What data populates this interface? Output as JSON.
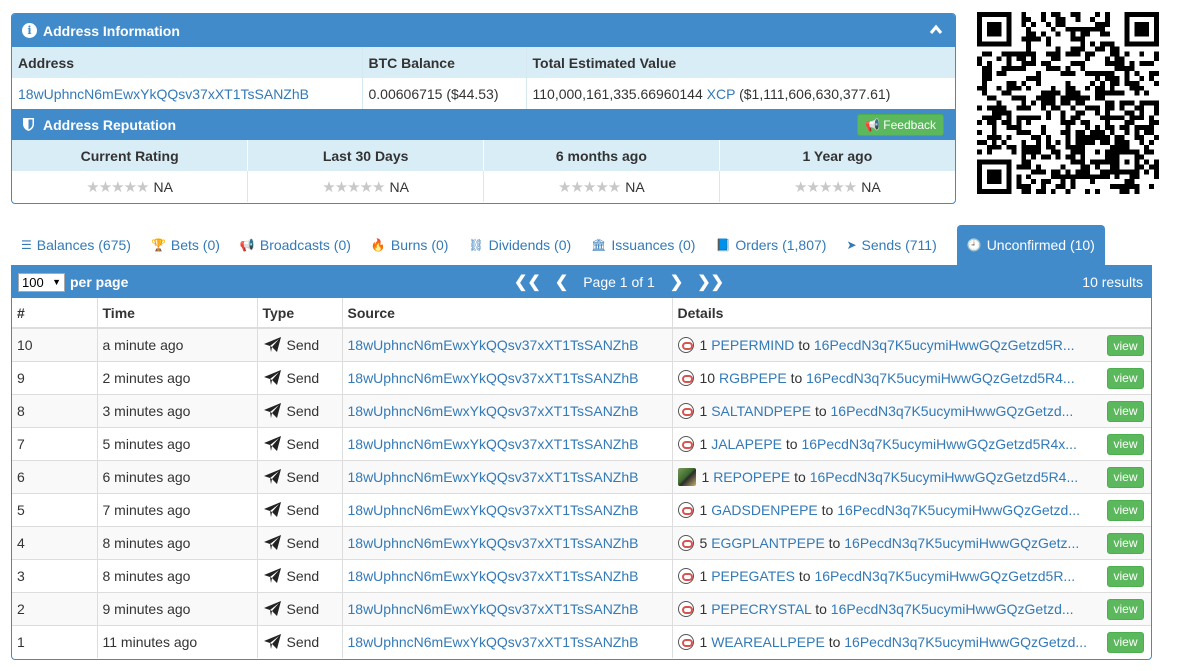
{
  "address_panel": {
    "title": "Address Information",
    "headers": [
      "Address",
      "BTC Balance",
      "Total Estimated Value"
    ],
    "address": "18wUphncN6mEwxYkQQsv37xXT1TsSANZhB",
    "btc_balance": "0.00606715 ($44.53)",
    "total_value_amount": "110,000,161,335.66960144",
    "total_value_unit": "XCP",
    "total_value_usd": "($1,111,606,630,377.61)"
  },
  "reputation": {
    "title": "Address Reputation",
    "feedback_label": "Feedback",
    "headers": [
      "Current Rating",
      "Last 30 Days",
      "6 months ago",
      "1 Year ago"
    ],
    "values": [
      "NA",
      "NA",
      "NA",
      "NA"
    ]
  },
  "tabs": [
    {
      "label": "Balances (675)",
      "icon": "list-icon",
      "glyph": "☰"
    },
    {
      "label": "Bets (0)",
      "icon": "trophy-icon",
      "glyph": "🏆"
    },
    {
      "label": "Broadcasts (0)",
      "icon": "bullhorn-icon",
      "glyph": "📢"
    },
    {
      "label": "Burns (0)",
      "icon": "fire-icon",
      "glyph": "🔥"
    },
    {
      "label": "Dividends (0)",
      "icon": "sitemap-icon",
      "glyph": "⛓"
    },
    {
      "label": "Issuances (0)",
      "icon": "bank-icon",
      "glyph": "🏛"
    },
    {
      "label": "Orders (1,807)",
      "icon": "book-icon",
      "glyph": "📘"
    },
    {
      "label": "Sends (711)",
      "icon": "send-icon",
      "glyph": "➤"
    },
    {
      "label": "Unconfirmed (10)",
      "icon": "clock-icon",
      "glyph": "🕘"
    }
  ],
  "toolbar": {
    "per_page_value": "100",
    "per_page_label": "per page",
    "page_text": "Page 1 of 1",
    "results": "10 results"
  },
  "table": {
    "headers": [
      "#",
      "Time",
      "Type",
      "Source",
      "Details"
    ],
    "view_label": "view",
    "rows": [
      {
        "num": "10",
        "time": "a minute ago",
        "type": "Send",
        "source": "18wUphncN6mEwxYkQQsv37xXT1TsSANZhB",
        "qty": "1",
        "asset": "PEPERMIND",
        "to": "to",
        "dest": "16PecdN3q7K5ucymiHwwGQzGetzd5R...",
        "icon": "coin-icon"
      },
      {
        "num": "9",
        "time": "2 minutes ago",
        "type": "Send",
        "source": "18wUphncN6mEwxYkQQsv37xXT1TsSANZhB",
        "qty": "10",
        "asset": "RGBPEPE",
        "to": "to",
        "dest": "16PecdN3q7K5ucymiHwwGQzGetzd5R4...",
        "icon": "coin-icon"
      },
      {
        "num": "8",
        "time": "3 minutes ago",
        "type": "Send",
        "source": "18wUphncN6mEwxYkQQsv37xXT1TsSANZhB",
        "qty": "1",
        "asset": "SALTANDPEPE",
        "to": "to",
        "dest": "16PecdN3q7K5ucymiHwwGQzGetzd...",
        "icon": "coin-icon"
      },
      {
        "num": "7",
        "time": "5 minutes ago",
        "type": "Send",
        "source": "18wUphncN6mEwxYkQQsv37xXT1TsSANZhB",
        "qty": "1",
        "asset": "JALAPEPE",
        "to": "to",
        "dest": "16PecdN3q7K5ucymiHwwGQzGetzd5R4x...",
        "icon": "coin-icon"
      },
      {
        "num": "6",
        "time": "6 minutes ago",
        "type": "Send",
        "source": "18wUphncN6mEwxYkQQsv37xXT1TsSANZhB",
        "qty": "1",
        "asset": "REPOPEPE",
        "to": "to",
        "dest": "16PecdN3q7K5ucymiHwwGQzGetzd5R4...",
        "icon": "image-icon"
      },
      {
        "num": "5",
        "time": "7 minutes ago",
        "type": "Send",
        "source": "18wUphncN6mEwxYkQQsv37xXT1TsSANZhB",
        "qty": "1",
        "asset": "GADSDENPEPE",
        "to": "to",
        "dest": "16PecdN3q7K5ucymiHwwGQzGetzd...",
        "icon": "coin-icon"
      },
      {
        "num": "4",
        "time": "8 minutes ago",
        "type": "Send",
        "source": "18wUphncN6mEwxYkQQsv37xXT1TsSANZhB",
        "qty": "5",
        "asset": "EGGPLANTPEPE",
        "to": "to",
        "dest": "16PecdN3q7K5ucymiHwwGQzGetz...",
        "icon": "coin-icon"
      },
      {
        "num": "3",
        "time": "8 minutes ago",
        "type": "Send",
        "source": "18wUphncN6mEwxYkQQsv37xXT1TsSANZhB",
        "qty": "1",
        "asset": "PEPEGATES",
        "to": "to",
        "dest": "16PecdN3q7K5ucymiHwwGQzGetzd5R...",
        "icon": "coin-icon"
      },
      {
        "num": "2",
        "time": "9 minutes ago",
        "type": "Send",
        "source": "18wUphncN6mEwxYkQQsv37xXT1TsSANZhB",
        "qty": "1",
        "asset": "PEPECRYSTAL",
        "to": "to",
        "dest": "16PecdN3q7K5ucymiHwwGQzGetzd...",
        "icon": "coin-icon"
      },
      {
        "num": "1",
        "time": "11 minutes ago",
        "type": "Send",
        "source": "18wUphncN6mEwxYkQQsv37xXT1TsSANZhB",
        "qty": "1",
        "asset": "WEAREALLPEPE",
        "to": "to",
        "dest": "16PecdN3q7K5ucymiHwwGQzGetzd...",
        "icon": "coin-icon"
      }
    ]
  },
  "colors": {
    "primary": "#428bca",
    "header_light": "#d9edf7",
    "success": "#5cb85c",
    "link": "#337ab7"
  }
}
